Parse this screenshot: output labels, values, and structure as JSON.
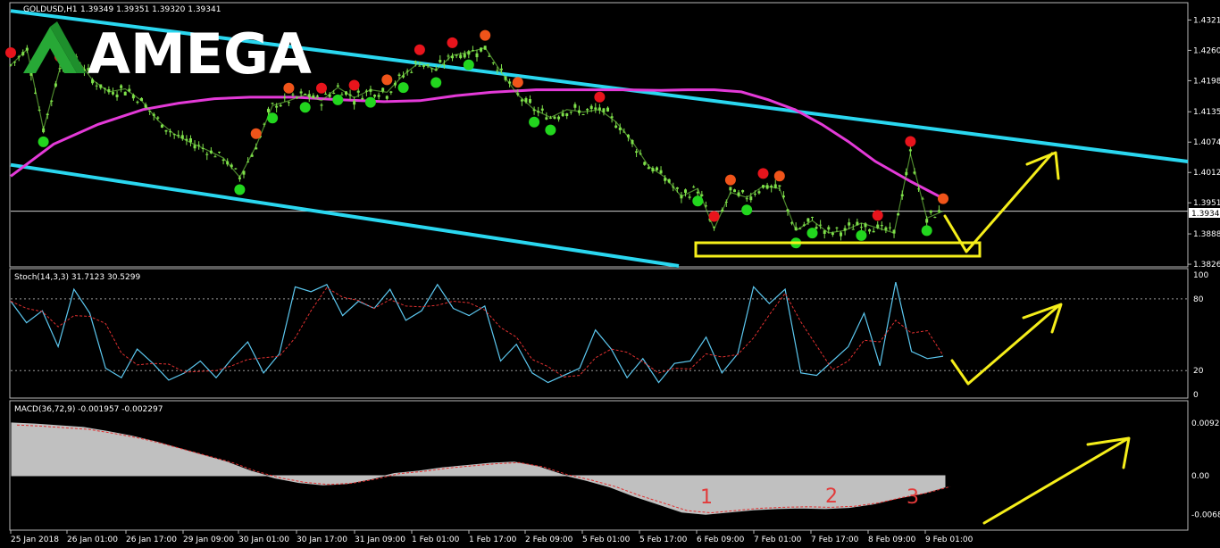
{
  "chart_data": [
    {
      "type": "line",
      "name": "price",
      "symbol_label": "GOLDUSD,H1",
      "ohlc_readout": "1.39349 1.39351 1.39320 1.39341",
      "y_ticks": [
        "1.43215",
        "1.42600",
        "1.41985",
        "1.41355",
        "1.40740",
        "1.40125",
        "1.39510",
        "1.38880",
        "1.38265"
      ],
      "y_tick_values": [
        1.43215,
        1.426,
        1.41985,
        1.41355,
        1.4074,
        1.40125,
        1.3951,
        1.3888,
        1.38265
      ],
      "current_price": "1.39341",
      "ylim": [
        1.3823,
        1.4353
      ],
      "close": [
        1.423,
        1.4262,
        1.41,
        1.4222,
        1.4244,
        1.42,
        1.4176,
        1.4182,
        1.4158,
        1.4118,
        1.409,
        1.4073,
        1.4058,
        1.4042,
        1.4003,
        1.4066,
        1.4148,
        1.4158,
        1.417,
        1.4158,
        1.4185,
        1.4164,
        1.418,
        1.4175,
        1.421,
        1.4236,
        1.422,
        1.425,
        1.4256,
        1.4265,
        1.4215,
        1.417,
        1.414,
        1.4124,
        1.414,
        1.4135,
        1.414,
        1.4115,
        1.4075,
        1.4025,
        1.4003,
        1.3964,
        1.398,
        1.3898,
        1.3972,
        1.3962,
        1.3985,
        1.398,
        1.3895,
        1.3915,
        1.389,
        1.3895,
        1.391,
        1.39,
        1.389,
        1.405,
        1.392,
        1.3934
      ],
      "ma": [
        1.4005,
        1.407,
        1.411,
        1.414,
        1.4153,
        1.4162,
        1.4165,
        1.4165,
        1.416,
        1.4156,
        1.4158,
        1.4168,
        1.4175,
        1.4178,
        1.418,
        1.418,
        1.418,
        1.4179,
        1.418,
        1.418,
        1.4176,
        1.416,
        1.414,
        1.411,
        1.4075,
        1.4035,
        1.3994,
        1.396
      ],
      "ma_x": [
        12,
        60,
        110,
        160,
        200,
        240,
        280,
        330,
        380,
        430,
        470,
        510,
        550,
        580,
        600,
        640,
        700,
        740,
        770,
        800,
        830,
        860,
        890,
        920,
        950,
        980,
        1020,
        1056
      ],
      "upper_channel": [
        1.434,
        1.4044
      ],
      "lower_channel": [
        1.4028,
        1.3823
      ]
    },
    {
      "type": "line",
      "name": "stochastic",
      "label": "Stoch(14,3,3) 31.7123 30.5299",
      "y_ticks": [
        "100",
        "80",
        "20",
        "0"
      ],
      "y_tick_values": [
        100,
        80,
        20,
        0
      ],
      "ylim": [
        0,
        100
      ],
      "k": [
        78,
        60,
        70,
        40,
        88,
        68,
        22,
        14,
        38,
        26,
        12,
        18,
        28,
        14,
        30,
        44,
        18,
        34,
        90,
        86,
        92,
        66,
        78,
        72,
        88,
        62,
        70,
        92,
        72,
        66,
        74,
        28,
        42,
        18,
        10,
        16,
        22,
        54,
        38,
        14,
        30,
        10,
        26,
        28,
        48,
        18,
        34,
        90,
        76,
        88,
        18,
        16,
        28,
        40,
        68,
        24,
        94,
        36,
        30,
        32
      ],
      "d_dashed": true
    },
    {
      "type": "area",
      "name": "macd",
      "label": "MACD(36,72,9) -0.001957 -0.002297",
      "y_ticks": [
        "0.009283",
        "0.00",
        "-0.006876"
      ],
      "y_tick_values": [
        0.009283,
        0.0,
        -0.006876
      ],
      "ylim": [
        -0.007266,
        0.009673
      ],
      "hist": [
        0.0093,
        0.0091,
        0.0088,
        0.0085,
        0.0078,
        0.007,
        0.006,
        0.0048,
        0.0036,
        0.0024,
        0.0008,
        -0.0004,
        -0.0012,
        -0.0016,
        -0.0014,
        -0.0006,
        0.0004,
        0.0008,
        0.0014,
        0.0018,
        0.0022,
        0.0024,
        0.0016,
        0.0002,
        -0.0008,
        -0.002,
        -0.0036,
        -0.005,
        -0.0064,
        -0.0068,
        -0.0064,
        -0.006,
        -0.0058,
        -0.0057,
        -0.0058,
        -0.0056,
        -0.005,
        -0.004,
        -0.0032,
        -0.002
      ],
      "signal_dashed": true
    }
  ],
  "x_axis_labels": [
    "25 Jan 2018",
    "26 Jan 01:00",
    "26 Jan 17:00",
    "29 Jan 09:00",
    "30 Jan 01:00",
    "30 Jan 17:00",
    "31 Jan 09:00",
    "1 Feb 01:00",
    "1 Feb 17:00",
    "2 Feb 09:00",
    "5 Feb 01:00",
    "5 Feb 17:00",
    "6 Feb 09:00",
    "7 Feb 01:00",
    "7 Feb 17:00",
    "8 Feb 09:00",
    "9 Feb 01:00"
  ],
  "logo": {
    "text": "AMEGA"
  },
  "annotations": {
    "labels": [
      "1",
      "2",
      "3"
    ]
  },
  "colors": {
    "background": "#000000",
    "candles": "#7ee04a",
    "channel": "#2ad7f0",
    "ma": "#e43ad8",
    "stoch_main": "#5cc8f0",
    "stoch_signal": "#e03030",
    "macd_hist": "#c0c0c0",
    "macd_signal": "#e03030",
    "arrows": "#f5ee1a",
    "box": "#f5ee1a",
    "dot_red": "#e8141c",
    "dot_orange": "#f0541a",
    "dot_green": "#22d61e",
    "annotation": "#e23a3a",
    "logo_green": "#27a836"
  }
}
